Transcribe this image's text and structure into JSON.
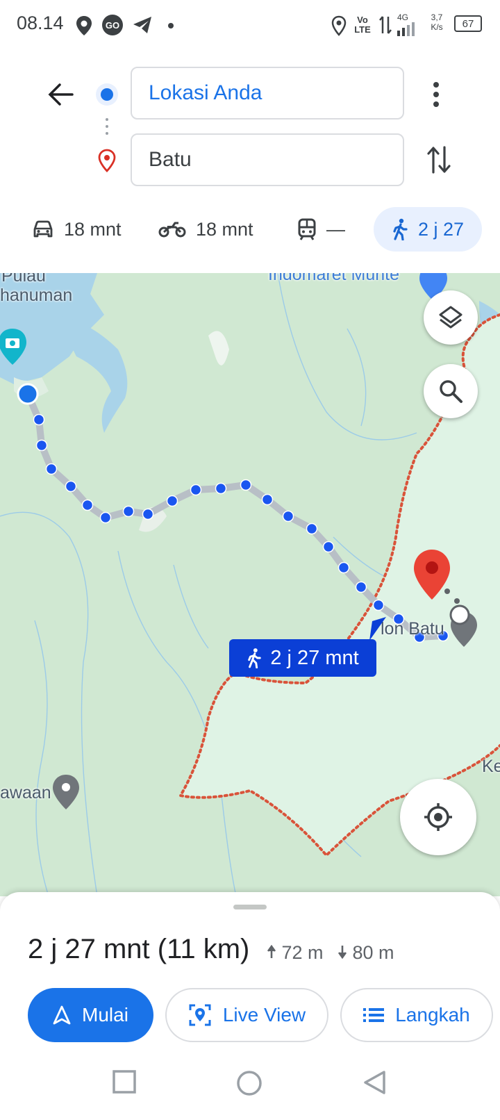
{
  "status_bar": {
    "time": "08.14",
    "network_speed_value": "3,7",
    "network_speed_unit": "K/s",
    "battery": "67",
    "signal_type": "4G",
    "volte": "Vo LTE"
  },
  "header": {
    "origin": "Lokasi Anda",
    "destination": "Batu",
    "modes": [
      {
        "icon": "car-icon",
        "label": "18 mnt"
      },
      {
        "icon": "motorcycle-icon",
        "label": "18 mnt"
      },
      {
        "icon": "train-icon",
        "label": "—"
      },
      {
        "icon": "walk-icon",
        "label": "2 j 27",
        "selected": true
      }
    ]
  },
  "map": {
    "labels": {
      "pulau": "Pulau",
      "hanuman": "hanuman",
      "indomaret": "Indomaret Munte",
      "batu_place": "lon Batu",
      "awaan": "awaan",
      "ke": "Ke"
    },
    "route_bubble": "2 j 27 mnt",
    "accent_blue": "#1a73e8",
    "route_dot_color": "#1a56f0",
    "destination_pin_color": "#ea4335",
    "boundary_color": "#d9533a"
  },
  "sheet": {
    "summary": "2 j 27 mnt (11 km)",
    "ascent": "72 m",
    "descent": "80 m",
    "start_label": "Mulai",
    "live_view_label": "Live View",
    "steps_label": "Langkah"
  }
}
